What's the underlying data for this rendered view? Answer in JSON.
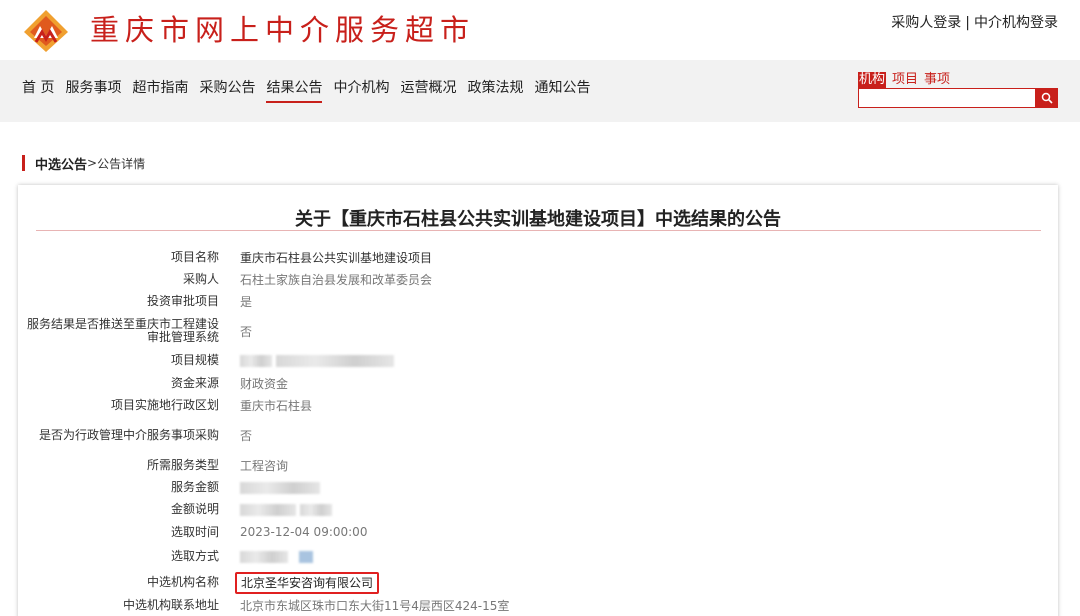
{
  "header": {
    "site_title": "重庆市网上中介服务超市",
    "login_buyer": "采购人登录",
    "login_sep": "|",
    "login_agency": "中介机构登录",
    "brand_color": "#c8201b"
  },
  "nav": {
    "items": [
      "首 页",
      "服务事项",
      "超市指南",
      "采购公告",
      "结果公告",
      "中介机构",
      "运营概况",
      "政策法规",
      "通知公告"
    ],
    "active": "结果公告"
  },
  "search": {
    "tabs": [
      "机构",
      "项目",
      "事项"
    ],
    "active_tab": "机构",
    "placeholder": "",
    "icon": "search-icon"
  },
  "breadcrumb": {
    "current": "中选公告",
    "separator": ">",
    "sub": "公告详情"
  },
  "notice": {
    "title": "关于【重庆市石柱县公共实训基地建设项目】中选结果的公告",
    "fields": [
      {
        "label": "项目名称",
        "value": "重庆市石柱县公共实训基地建设项目"
      },
      {
        "label": "采购人",
        "value": "石柱土家族自治县发展和改革委员会"
      },
      {
        "label": "投资审批项目",
        "value": "是"
      },
      {
        "label": "服务结果是否推送至重庆市工程建设审批管理系统",
        "value": "否"
      },
      {
        "label": "项目规模",
        "value": ""
      },
      {
        "label": "资金来源",
        "value": "财政资金"
      },
      {
        "label": "项目实施地行政区划",
        "value": "重庆市石柱县"
      },
      {
        "label": "是否为行政管理中介服务事项采购",
        "value": "否"
      },
      {
        "label": "所需服务类型",
        "value": "工程咨询"
      },
      {
        "label": "服务金额",
        "value": ""
      },
      {
        "label": "金额说明",
        "value": ""
      },
      {
        "label": "选取时间",
        "value": "2023-12-04 09:00:00"
      },
      {
        "label": "选取方式",
        "value": ""
      },
      {
        "label": "中选机构名称",
        "value": "北京圣华安咨询有限公司"
      },
      {
        "label": "中选机构联系地址",
        "value": "北京市东城区珠市口东大街11号4层西区424-15室"
      }
    ]
  }
}
